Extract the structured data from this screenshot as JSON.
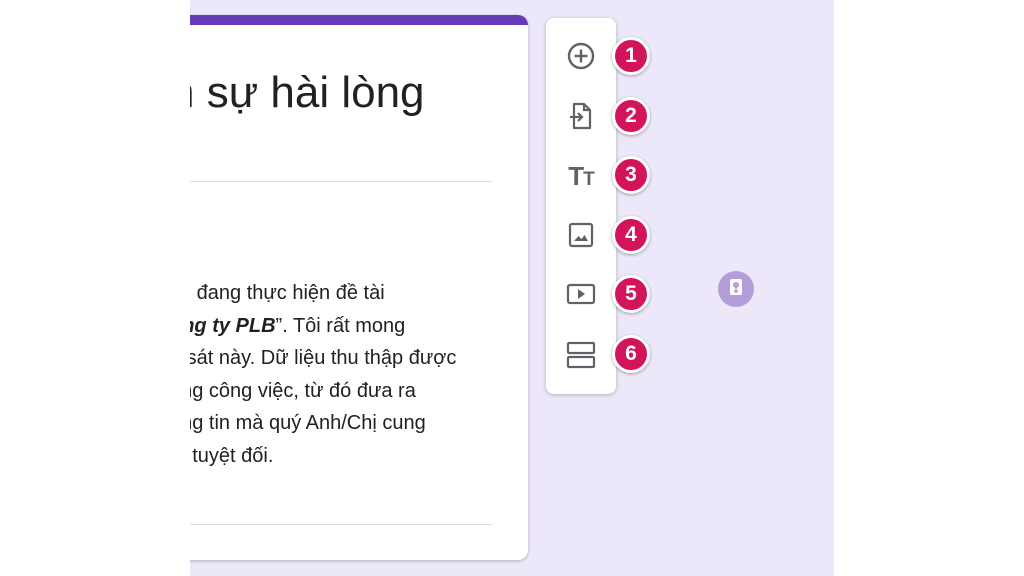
{
  "form": {
    "title": "n sự hài lòng",
    "description_lines": [
      {
        "text": "tôi đang thực hiện đề tài",
        "bold": ""
      },
      {
        "text": "",
        "bold": "ông ty PLB",
        "after": "”. Tôi rất mong"
      },
      {
        "text": "o sát này. Dữ liệu thu thập được",
        "bold": ""
      },
      {
        "text": "ong công việc, từ đó đưa ra",
        "bold": ""
      },
      {
        "text": "ông tin mà quý Anh/Chị cung",
        "bold": ""
      },
      {
        "text": "ật tuyệt đối.",
        "bold": ""
      }
    ]
  },
  "toolbar": {
    "items": [
      {
        "name": "add-question-button",
        "icon": "add-circle-icon",
        "badge": "1"
      },
      {
        "name": "import-questions-button",
        "icon": "import-icon",
        "badge": "2"
      },
      {
        "name": "add-title-description-button",
        "icon": "title-text-icon",
        "badge": "3"
      },
      {
        "name": "add-image-button",
        "icon": "image-icon",
        "badge": "4"
      },
      {
        "name": "add-video-button",
        "icon": "video-icon",
        "badge": "5"
      },
      {
        "name": "add-section-button",
        "icon": "section-icon",
        "badge": "6"
      }
    ],
    "title_icon_text": "T",
    "title_icon_small": "T"
  },
  "colors": {
    "accent": "#673ab7",
    "badge": "#d4145a",
    "canvas_bg": "#ede8f9",
    "icon": "#5f6368"
  },
  "floating_button": {
    "icon": "assistant-icon"
  }
}
